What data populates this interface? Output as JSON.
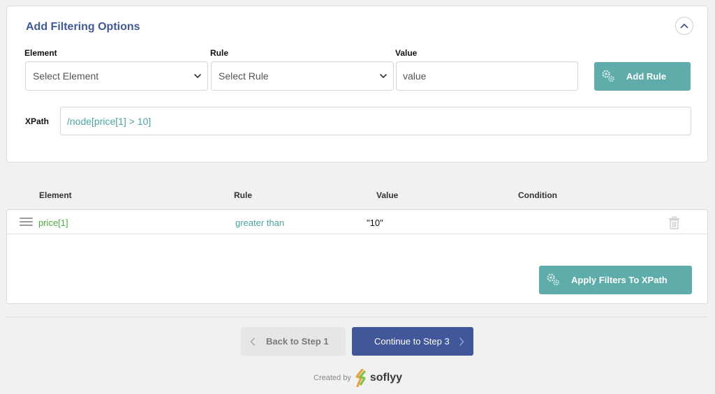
{
  "panel": {
    "title": "Add Filtering Options"
  },
  "fields": {
    "element_label": "Element",
    "element_placeholder": "Select Element",
    "rule_label": "Rule",
    "rule_placeholder": "Select Rule",
    "value_label": "Value",
    "value_placeholder": "value",
    "value_value": ""
  },
  "add_rule_label": "Add Rule",
  "xpath": {
    "label": "XPath",
    "value": "/node[price[1] > 10]"
  },
  "table": {
    "headers": [
      "Element",
      "Rule",
      "Value",
      "Condition"
    ],
    "rows": [
      {
        "element": "price[1]",
        "rule": "greater than",
        "value": "\"10\"",
        "condition": ""
      }
    ]
  },
  "apply_label": "Apply Filters To XPath",
  "nav": {
    "back_label": "Back to Step 1",
    "continue_label": "Continue to Step 3"
  },
  "footer": {
    "created_by": "Created by",
    "brand": "soflyy"
  },
  "colors": {
    "accent_teal": "#5fadaa",
    "primary_blue": "#42579a",
    "title_blue": "#40599a",
    "element_green": "#4aaa3f",
    "rule_teal": "#4ba6a2"
  },
  "icons": [
    "chevron-up-icon",
    "chevron-down-icon",
    "gears-icon",
    "drag-handle-icon",
    "trash-icon",
    "chevron-left-icon",
    "chevron-right-icon",
    "soflyy-logo-icon"
  ]
}
